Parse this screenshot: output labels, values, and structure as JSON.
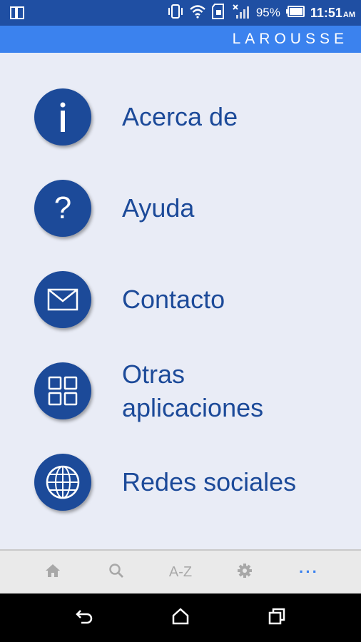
{
  "status_bar": {
    "battery_percent": "95%",
    "time": "11:51",
    "ampm": "AM"
  },
  "app_bar": {
    "brand": "LAROUSSE"
  },
  "menu": {
    "items": [
      {
        "label": "Acerca de",
        "icon": "info-icon"
      },
      {
        "label": "Ayuda",
        "icon": "help-icon"
      },
      {
        "label": "Contacto",
        "icon": "mail-icon"
      },
      {
        "label": "Otras aplicaciones",
        "label_line1": "Otras",
        "label_line2": "aplicaciones",
        "icon": "apps-grid-icon"
      },
      {
        "label": "Redes sociales",
        "icon": "globe-icon"
      }
    ]
  },
  "bottom_nav": {
    "items": [
      {
        "name": "home",
        "icon": "home-icon"
      },
      {
        "name": "search",
        "icon": "search-icon"
      },
      {
        "name": "az",
        "text": "A-Z"
      },
      {
        "name": "settings",
        "icon": "gear-icon"
      },
      {
        "name": "more",
        "text": "···",
        "active": true
      }
    ]
  },
  "colors": {
    "status_bar": "#1f4fa3",
    "app_bar": "#3b82ee",
    "accent_dark": "#1c4a99",
    "background": "#e9ecf6",
    "nav_active": "#3b82ee",
    "nav_inactive": "#a8a8a8"
  }
}
